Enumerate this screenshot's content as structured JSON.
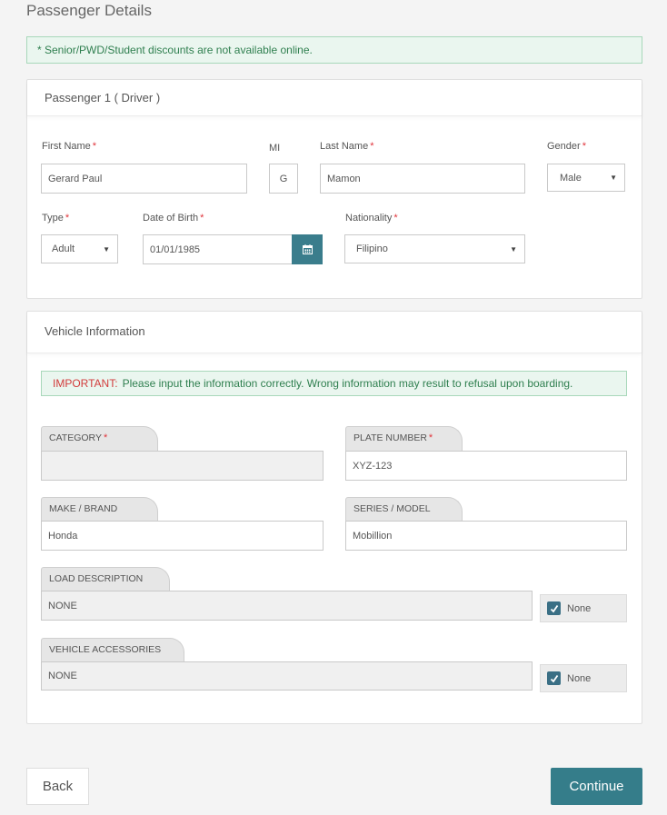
{
  "page": {
    "title": "Passenger Details",
    "notice": "* Senior/PWD/Student discounts are not available online."
  },
  "passenger": {
    "header": "Passenger 1 ( Driver )",
    "first_name": {
      "label": "First Name",
      "value": "Gerard Paul",
      "required": "*"
    },
    "mi": {
      "label": "MI",
      "value": "G"
    },
    "last_name": {
      "label": "Last Name",
      "value": "Mamon",
      "required": "*"
    },
    "gender": {
      "label": "Gender",
      "value": "Male",
      "required": "*"
    },
    "type": {
      "label": "Type",
      "value": "Adult",
      "required": "*"
    },
    "dob": {
      "label": "Date of Birth",
      "value": "01/01/1985",
      "required": "*"
    },
    "nationality": {
      "label": "Nationality",
      "value": "Filipino",
      "required": "*"
    }
  },
  "vehicle": {
    "header": "Vehicle Information",
    "warning_prefix": "IMPORTANT:",
    "warning_text": "Please input the information correctly. Wrong information may result to refusal upon boarding.",
    "category": {
      "label": "CATEGORY",
      "value": "",
      "required": "*"
    },
    "plate_number": {
      "label": "PLATE NUMBER",
      "value": "XYZ-123",
      "required": "*"
    },
    "make": {
      "label": "MAKE / BRAND",
      "value": "Honda"
    },
    "series": {
      "label": "SERIES / MODEL",
      "value": "Mobillion"
    },
    "load_description": {
      "label": "LOAD DESCRIPTION",
      "value": "NONE",
      "none_label": "None"
    },
    "accessories": {
      "label": "VEHICLE ACCESSORIES",
      "value": "NONE",
      "none_label": "None"
    }
  },
  "actions": {
    "back": "Back",
    "continue": "Continue"
  },
  "colors": {
    "accent": "#357d8a",
    "required": "#e0343b",
    "notice_bg": "#eaf6ef"
  }
}
